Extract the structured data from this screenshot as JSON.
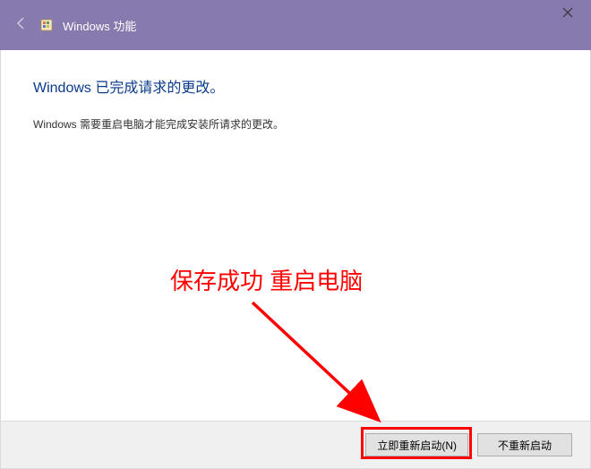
{
  "titlebar": {
    "title": "Windows 功能"
  },
  "content": {
    "heading": "Windows 已完成请求的更改。",
    "body": "Windows 需要重启电脑才能完成安装所请求的更改。"
  },
  "footer": {
    "restart_now": "立即重新启动(N)",
    "no_restart": "不重新启动"
  },
  "annotation": {
    "text": "保存成功 重启电脑"
  }
}
